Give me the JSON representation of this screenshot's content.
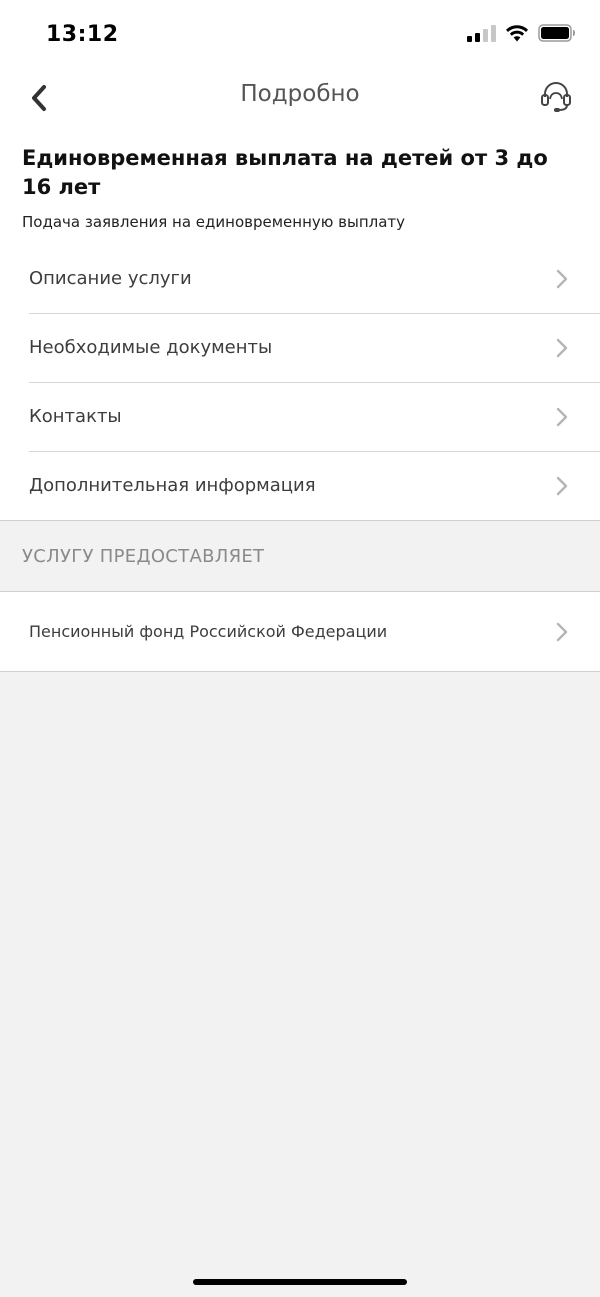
{
  "status_bar": {
    "time": "13:12"
  },
  "nav": {
    "title": "Подробно",
    "back_icon": "chevron-left-icon",
    "support_icon": "headset-icon"
  },
  "header": {
    "title": "Единовременная выплата на детей от 3 до 16 лет",
    "subtitle": "Подача заявления на единовременную выплату"
  },
  "menu": {
    "items": [
      {
        "label": "Описание услуги"
      },
      {
        "label": "Необходимые документы"
      },
      {
        "label": "Контакты"
      },
      {
        "label": "Дополнительная информация"
      }
    ]
  },
  "provider_section": {
    "header": "УСЛУГУ ПРЕДОСТАВЛЯЕТ",
    "provider": "Пенсионный фонд Российской Федерации"
  },
  "colors": {
    "background": "#f2f2f2",
    "surface": "#ffffff",
    "chevron": "#b5b5b5",
    "section_text": "#8a8a8a"
  }
}
